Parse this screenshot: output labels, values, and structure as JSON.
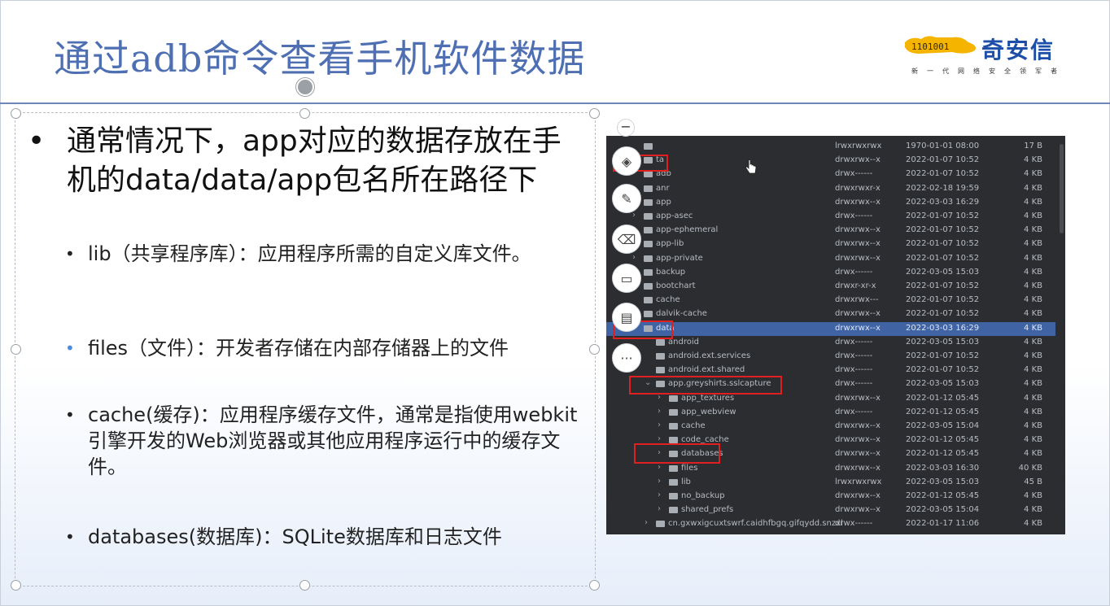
{
  "slide": {
    "title": "通过adb命令查看手机软件数据",
    "logo": {
      "name": "奇安信",
      "mark_text": "1101001",
      "slogan": "新一代网络安全领军者",
      "brand_color": "#1d4fa8",
      "mark_color": "#f4b400"
    },
    "main_bullet": {
      "bullet": "•",
      "text": "通常情况下，app对应的数据存放在手机的data/data/app包名所在路径下"
    },
    "sub_bullets": [
      {
        "bullet": "•",
        "text": "lib（共享程序库）：应用程序所需的自定义库文件。"
      },
      {
        "bullet": "•",
        "text": "files（文件）：开发者存储在内部存储器上的文件"
      },
      {
        "bullet": "•",
        "text": "cache(缓存)：应用程序缓存文件，通常是指使用webkit引擎开发的Web浏览器或其他应用程序运行中的缓存文件。"
      },
      {
        "bullet": "•",
        "text": "databases(数据库)：SQLite数据库和日志文件"
      }
    ]
  },
  "toolbar": {
    "collapse_label": "−",
    "buttons": [
      {
        "icon": "layers-icon",
        "glyph": "◈"
      },
      {
        "icon": "pen-icon",
        "glyph": "✎"
      },
      {
        "icon": "eraser-icon",
        "glyph": "⌫"
      },
      {
        "icon": "screen-icon",
        "glyph": "▭"
      },
      {
        "icon": "document-icon",
        "glyph": "▤"
      },
      {
        "icon": "more-icon",
        "glyph": "···"
      }
    ]
  },
  "explorer": {
    "rows": [
      {
        "name": "",
        "perm": "lrwxrwxrwx",
        "date": "1970-01-01 08:00",
        "size": "17 B",
        "depth": 0,
        "chev": ""
      },
      {
        "name": "ta",
        "perm": "drwxrwx--x",
        "date": "2022-01-07 10:52",
        "size": "4 KB",
        "depth": 0,
        "chev": ""
      },
      {
        "name": "adb",
        "perm": "drwx------",
        "date": "2022-01-07 10:52",
        "size": "4 KB",
        "depth": 0,
        "chev": ""
      },
      {
        "name": "anr",
        "perm": "drwxrwxr-x",
        "date": "2022-02-18 19:59",
        "size": "4 KB",
        "depth": 0,
        "chev": ""
      },
      {
        "name": "app",
        "perm": "drwxrwx--x",
        "date": "2022-03-03 16:29",
        "size": "4 KB",
        "depth": 0,
        "chev": ""
      },
      {
        "name": "app-asec",
        "perm": "drwx------",
        "date": "2022-01-07 10:52",
        "size": "4 KB",
        "depth": 0,
        "chev": "›"
      },
      {
        "name": "app-ephemeral",
        "perm": "drwxrwx--x",
        "date": "2022-01-07 10:52",
        "size": "4 KB",
        "depth": 0,
        "chev": ""
      },
      {
        "name": "app-lib",
        "perm": "drwxrwx--x",
        "date": "2022-01-07 10:52",
        "size": "4 KB",
        "depth": 0,
        "chev": ""
      },
      {
        "name": "app-private",
        "perm": "drwxrwx--x",
        "date": "2022-01-07 10:52",
        "size": "4 KB",
        "depth": 0,
        "chev": "›"
      },
      {
        "name": "backup",
        "perm": "drwx------",
        "date": "2022-03-05 15:03",
        "size": "4 KB",
        "depth": 0,
        "chev": ""
      },
      {
        "name": "bootchart",
        "perm": "drwxr-xr-x",
        "date": "2022-01-07 10:52",
        "size": "4 KB",
        "depth": 0,
        "chev": ""
      },
      {
        "name": "cache",
        "perm": "drwxrwx---",
        "date": "2022-01-07 10:52",
        "size": "4 KB",
        "depth": 0,
        "chev": ""
      },
      {
        "name": "dalvik-cache",
        "perm": "drwxrwx--x",
        "date": "2022-01-07 10:52",
        "size": "4 KB",
        "depth": 0,
        "chev": ""
      },
      {
        "name": "data",
        "perm": "drwxrwx--x",
        "date": "2022-03-03 16:29",
        "size": "4 KB",
        "depth": 0,
        "chev": "",
        "selected": true
      },
      {
        "name": "android",
        "perm": "drwx------",
        "date": "2022-03-05 15:03",
        "size": "4 KB",
        "depth": 1,
        "chev": ""
      },
      {
        "name": "android.ext.services",
        "perm": "drwx------",
        "date": "2022-01-07 10:52",
        "size": "4 KB",
        "depth": 1,
        "chev": ""
      },
      {
        "name": "android.ext.shared",
        "perm": "drwx------",
        "date": "2022-01-07 10:52",
        "size": "4 KB",
        "depth": 1,
        "chev": ""
      },
      {
        "name": "app.greyshirts.sslcapture",
        "perm": "drwx------",
        "date": "2022-03-05 15:03",
        "size": "4 KB",
        "depth": 1,
        "chev": "⌄"
      },
      {
        "name": "app_textures",
        "perm": "drwxrwx--x",
        "date": "2022-01-12 05:45",
        "size": "4 KB",
        "depth": 2,
        "chev": "›"
      },
      {
        "name": "app_webview",
        "perm": "drwx------",
        "date": "2022-01-12 05:45",
        "size": "4 KB",
        "depth": 2,
        "chev": "›"
      },
      {
        "name": "cache",
        "perm": "drwxrwx--x",
        "date": "2022-03-05 15:04",
        "size": "4 KB",
        "depth": 2,
        "chev": "›"
      },
      {
        "name": "code_cache",
        "perm": "drwxrwx--x",
        "date": "2022-01-12 05:45",
        "size": "4 KB",
        "depth": 2,
        "chev": "›"
      },
      {
        "name": "databases",
        "perm": "drwxrwx--x",
        "date": "2022-01-12 05:45",
        "size": "4 KB",
        "depth": 2,
        "chev": "›"
      },
      {
        "name": "files",
        "perm": "drwxrwx--x",
        "date": "2022-03-03 16:30",
        "size": "40 KB",
        "depth": 2,
        "chev": "›"
      },
      {
        "name": "lib",
        "perm": "lrwxrwxrwx",
        "date": "2022-03-05 15:03",
        "size": "45 B",
        "depth": 2,
        "chev": "›"
      },
      {
        "name": "no_backup",
        "perm": "drwxrwx--x",
        "date": "2022-01-12 05:45",
        "size": "4 KB",
        "depth": 2,
        "chev": "›"
      },
      {
        "name": "shared_prefs",
        "perm": "drwxrwx--x",
        "date": "2022-03-05 15:04",
        "size": "4 KB",
        "depth": 2,
        "chev": "›"
      },
      {
        "name": "cn.gxwxigcuxtswrf.caidhfbgq.gifqydd.snzxl",
        "perm": "drwx------",
        "date": "2022-01-17 11:06",
        "size": "4 KB",
        "depth": 1,
        "chev": "›"
      }
    ],
    "highlight_color": "#e02020",
    "selection_color": "#3f63a3"
  }
}
